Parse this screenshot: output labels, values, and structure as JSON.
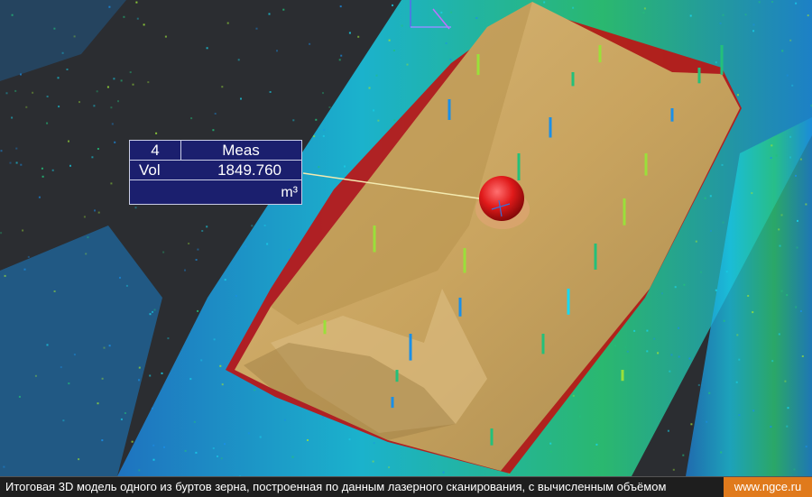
{
  "measurement": {
    "id": "4",
    "label": "Meas",
    "quantity": "Vol",
    "value": "1849.760",
    "unit": "m³"
  },
  "caption": {
    "text": "Итоговая 3D модель одного из буртов зерна, построенная по данным лазерного сканирования, с вычисленным объёмом",
    "site": "www.ngce.ru"
  },
  "scene": {
    "background_color": "#2b2d31",
    "pile_color": "#c9a45f",
    "marker_color": "#e01a1a",
    "point_cloud_colors": [
      "#18d8f0",
      "#23c07a",
      "#1a8fe8",
      "#9ae03a"
    ]
  }
}
